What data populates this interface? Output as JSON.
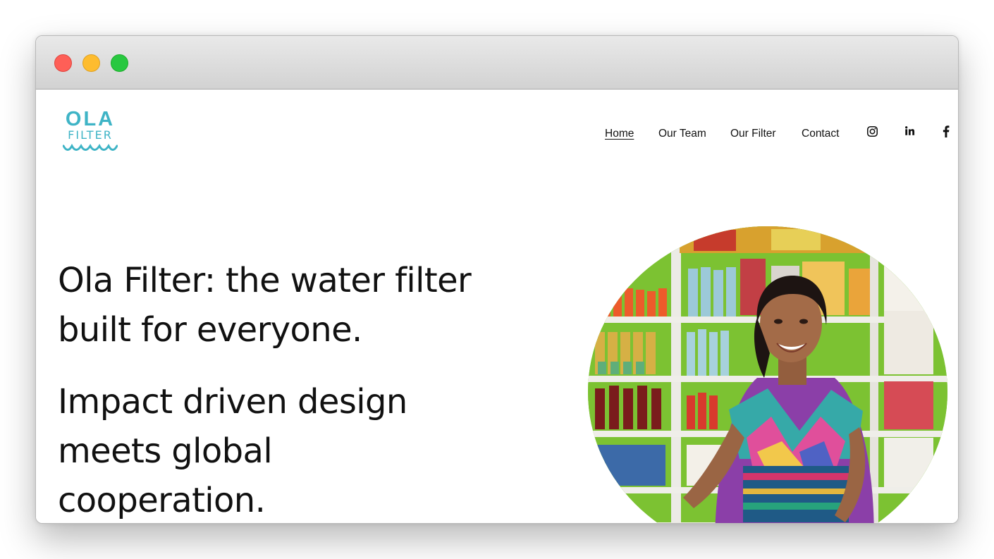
{
  "window": {
    "controls": [
      "close",
      "minimize",
      "maximize"
    ]
  },
  "logo": {
    "line1": "OLA",
    "line2": "FILTER",
    "color": "#3fb4c6"
  },
  "nav": {
    "items": [
      {
        "label": "Home",
        "active": true
      },
      {
        "label": "Our Team",
        "active": false
      },
      {
        "label": "Our Filter",
        "active": false
      },
      {
        "label": "Contact",
        "active": false
      }
    ],
    "social": [
      "instagram-icon",
      "linkedin-icon",
      "facebook-icon"
    ]
  },
  "hero": {
    "headline": "Ola Filter: the water filter built for everyone.",
    "subheadline": "Impact driven design meets global cooperation."
  },
  "colors": {
    "text": "#111111",
    "accent": "#3fb4c6"
  }
}
